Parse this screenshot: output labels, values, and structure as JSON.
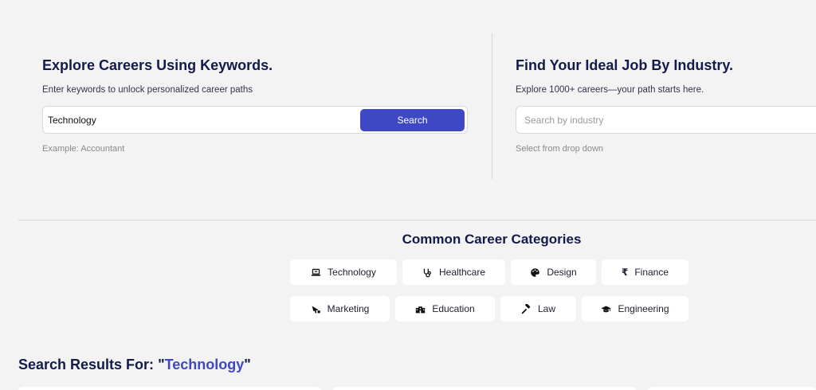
{
  "keyword_panel": {
    "title": "Explore Careers Using Keywords.",
    "subtitle": "Enter keywords to unlock personalized career paths",
    "input_value": "Technology",
    "button_label": "Search",
    "hint": "Example: Accountant"
  },
  "industry_panel": {
    "title": "Find Your Ideal Job By Industry.",
    "subtitle": "Explore 1000+ careers—your path starts here.",
    "input_placeholder": "Search by industry",
    "hint": "Select from drop down"
  },
  "categories": {
    "title": "Common Career Categories",
    "items": [
      {
        "label": "Technology",
        "icon": "laptop-icon"
      },
      {
        "label": "Healthcare",
        "icon": "stethoscope-icon"
      },
      {
        "label": "Design",
        "icon": "palette-icon"
      },
      {
        "label": "Finance",
        "icon": "rupee-icon"
      },
      {
        "label": "Marketing",
        "icon": "bullhorn-icon"
      },
      {
        "label": "Education",
        "icon": "school-icon"
      },
      {
        "label": "Law",
        "icon": "gavel-icon"
      },
      {
        "label": "Engineering",
        "icon": "graduation-cap-icon"
      }
    ]
  },
  "results": {
    "prefix": "Search Results For: ",
    "open_quote": "\"",
    "query": "Technology",
    "close_quote": "\""
  },
  "colors": {
    "accent": "#3f48c4",
    "heading": "#141a4a",
    "background": "#f3f3f3"
  }
}
